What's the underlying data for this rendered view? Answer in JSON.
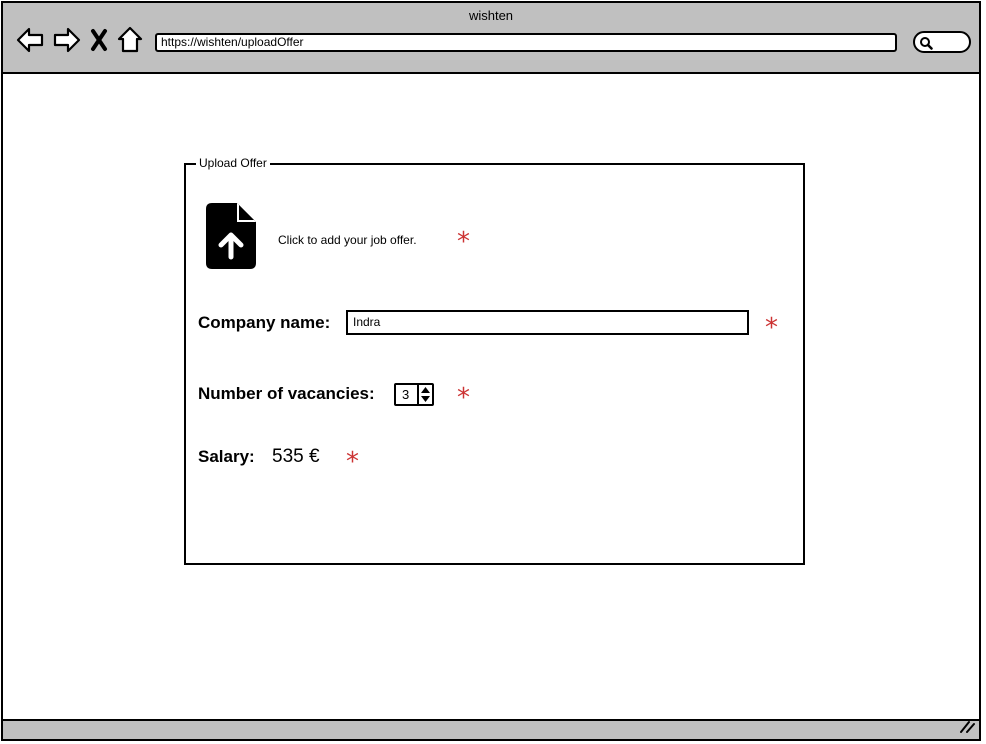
{
  "window": {
    "title": "wishten",
    "url": "https://wishten/uploadOffer"
  },
  "form": {
    "legend": "Upload Offer",
    "upload_label": "Click to add your job offer.",
    "required_marker": "*",
    "company": {
      "label": "Company name:",
      "value": "Indra"
    },
    "vacancies": {
      "label": "Number of vacancies:",
      "value": "3"
    },
    "salary": {
      "label": "Salary:",
      "value": "535 €"
    }
  },
  "colors": {
    "chrome": "#c0c0c0",
    "required": "#cc3333"
  }
}
